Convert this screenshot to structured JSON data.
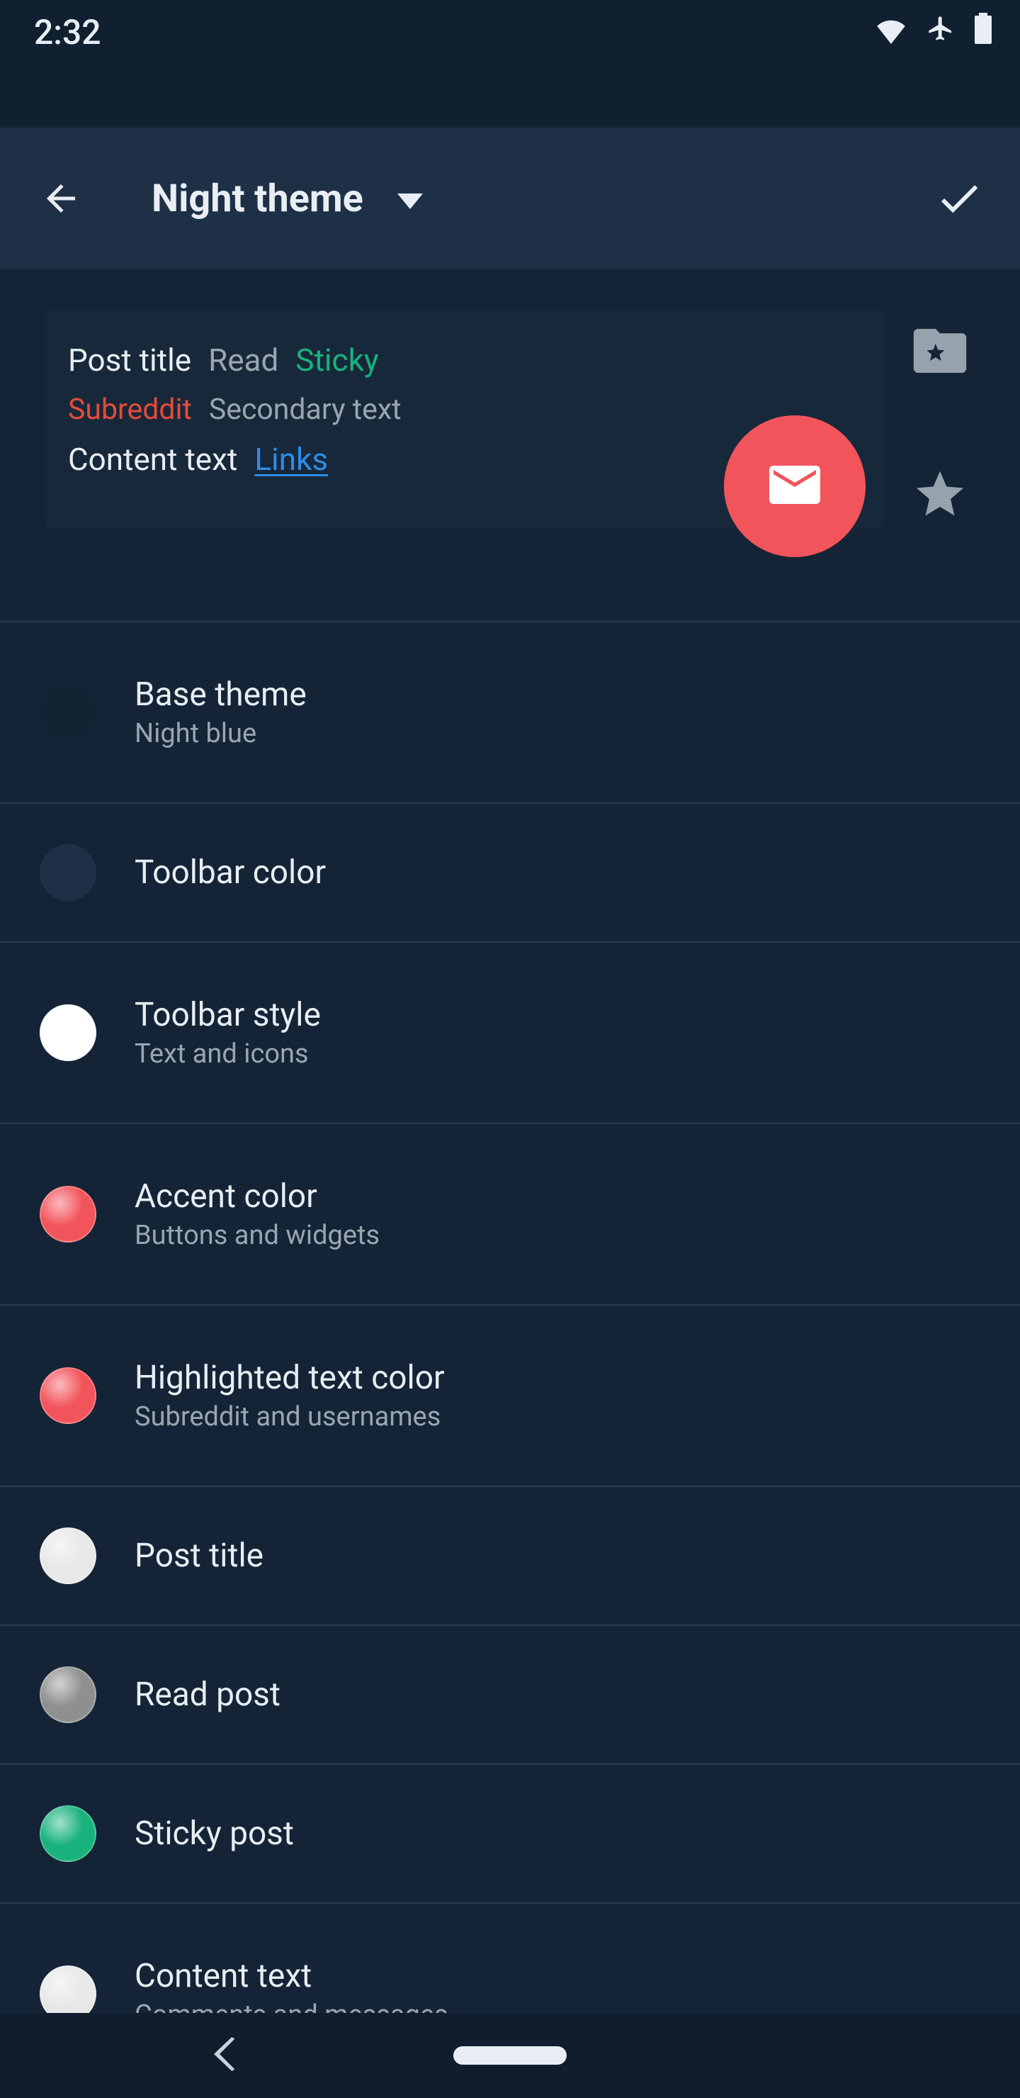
{
  "status": {
    "time": "2:32"
  },
  "toolbar": {
    "title": "Night theme"
  },
  "preview": {
    "post_title": "Post title",
    "read": "Read",
    "sticky": "Sticky",
    "subreddit": "Subreddit",
    "secondary": "Secondary text",
    "content": "Content text",
    "links": "Links"
  },
  "settings": [
    {
      "title": "Base theme",
      "subtitle": "Night blue",
      "swatch": "#132333",
      "gloss": false
    },
    {
      "title": "Toolbar color",
      "subtitle": "",
      "swatch": "#1d3046",
      "gloss": false
    },
    {
      "title": "Toolbar style",
      "subtitle": "Text and icons",
      "swatch": "#ffffff",
      "gloss": true
    },
    {
      "title": "Accent color",
      "subtitle": "Buttons and widgets",
      "swatch": "#f2545b",
      "gloss": true
    },
    {
      "title": "Highlighted text color",
      "subtitle": "Subreddit and usernames",
      "swatch": "#f2545b",
      "gloss": true
    },
    {
      "title": "Post title",
      "subtitle": "",
      "swatch": "#e8e8e8",
      "gloss": true
    },
    {
      "title": "Read post",
      "subtitle": "",
      "swatch": "#8f8f8f",
      "gloss": true
    },
    {
      "title": "Sticky post",
      "subtitle": "",
      "swatch": "#19b27c",
      "gloss": true
    },
    {
      "title": "Content text",
      "subtitle": "Comments and messages",
      "swatch": "#e8e8e8",
      "gloss": true
    }
  ]
}
